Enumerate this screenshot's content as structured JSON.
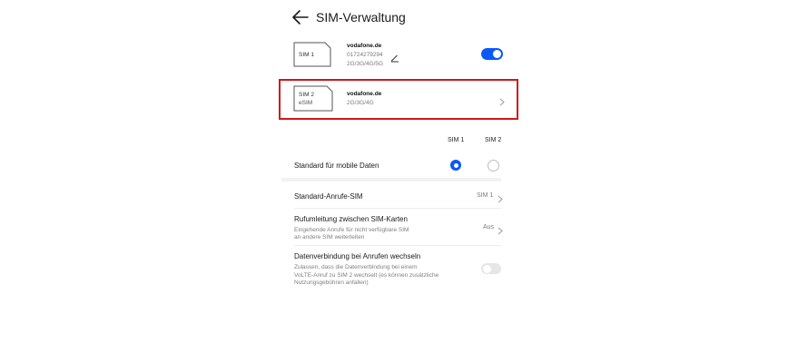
{
  "header": {
    "title": "SIM-Verwaltung",
    "back_icon": "arrow-left-icon"
  },
  "sim1": {
    "card_label": "SIM 1",
    "carrier": "vodafone.de",
    "number": "01724279294",
    "networks": "2G/3G/4G/5G",
    "edit_icon": "pencil-icon",
    "enabled": true
  },
  "sim2": {
    "card_label": "SIM 2",
    "card_sublabel": "eSIM",
    "carrier": "vodafone.de",
    "networks": "2G/3G/4G",
    "chevron_icon": "chevron-right-icon"
  },
  "columns": {
    "sim1": "SIM 1",
    "sim2": "SIM 2"
  },
  "mobile_data": {
    "label": "Standard für mobile Daten",
    "selected": "SIM 1"
  },
  "default_calls": {
    "label": "Standard-Anrufe-SIM",
    "value": "SIM 1"
  },
  "forwarding": {
    "label": "Rufumleitung zwischen SIM-Karten",
    "desc_line1": "Eingehende Anrufe für nicht verfügbare SIM",
    "desc_line2": "an andere SIM weiterleiten",
    "value": "Aus"
  },
  "data_switch": {
    "label": "Datenverbindung bei Anrufen wechseln",
    "desc_line1": "Zulassen, dass die Datenverbindung bei einem",
    "desc_line2": "VoLTE-Anruf zu SIM 2 wechselt (es können zusätzliche",
    "desc_line3": "Nutzungsgebühren anfallen)",
    "enabled": false
  },
  "colors": {
    "accent": "#0a59f7",
    "highlight": "#cc1a1a"
  }
}
